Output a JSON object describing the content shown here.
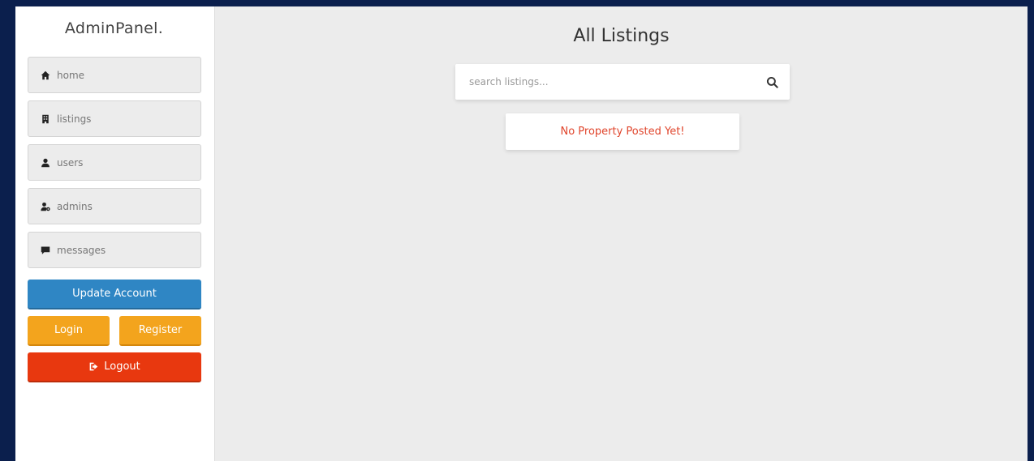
{
  "brand": {
    "name": "AdminPanel."
  },
  "sidebar": {
    "items": [
      {
        "label": "home",
        "icon": "home-icon"
      },
      {
        "label": "listings",
        "icon": "building-icon"
      },
      {
        "label": "users",
        "icon": "user-icon"
      },
      {
        "label": "admins",
        "icon": "user-gear-icon"
      },
      {
        "label": "messages",
        "icon": "comment-icon"
      }
    ]
  },
  "actions": {
    "update_label": "Update Account",
    "login_label": "Login",
    "register_label": "Register",
    "logout_label": "Logout",
    "logout_icon": "sign-out-icon"
  },
  "main": {
    "title": "All Listings",
    "search": {
      "placeholder": "search listings...",
      "value": "",
      "icon": "search-icon"
    },
    "empty_message": "No Property Posted Yet!"
  },
  "colors": {
    "update": "#2f86c4",
    "auth": "#f3a41d",
    "logout": "#e8380f",
    "empty_text": "#e0452c",
    "page_border": "#0b1f4d"
  }
}
